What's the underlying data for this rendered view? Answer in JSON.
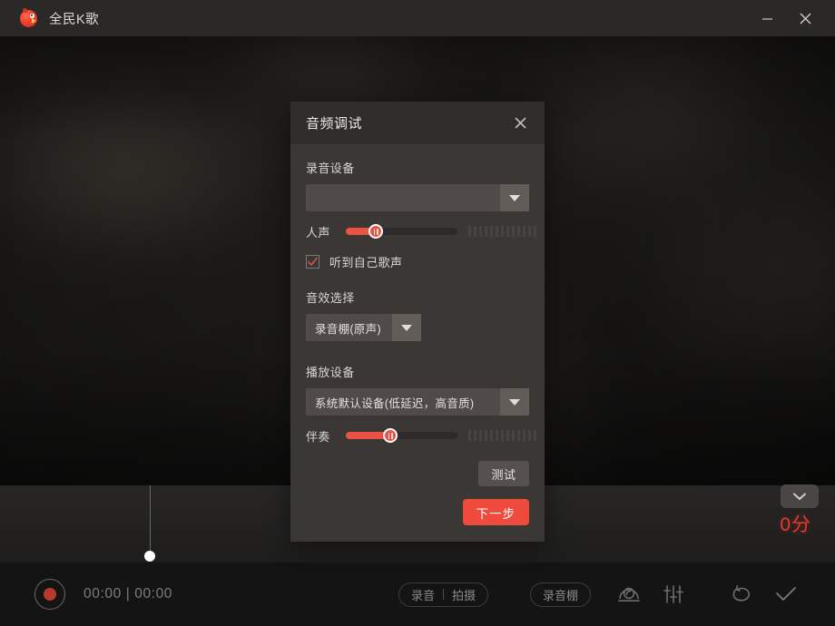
{
  "window": {
    "title": "全民K歌",
    "logo_icon": "kugou-bird-logo",
    "minimize_icon": "minimize-icon",
    "close_icon": "close-icon"
  },
  "stage": {
    "score": "0分",
    "collapse_icon": "chevron-down-icon"
  },
  "toolbar": {
    "record_icon": "record-dot-icon",
    "timer": "00:00 | 00:00",
    "mode_pill": {
      "left": "录音",
      "right": "拍摄"
    },
    "room_pill": "录音棚",
    "icons": [
      {
        "name": "headset-icon",
        "label": "耳机"
      },
      {
        "name": "equalizer-icon",
        "label": "音效调节"
      },
      {
        "name": "redo-icon",
        "label": "重录"
      },
      {
        "name": "check-icon",
        "label": "完成"
      }
    ]
  },
  "dialog": {
    "title": "音频调试",
    "close_icon": "close-icon",
    "record_device": {
      "label": "录音设备",
      "value": "",
      "placeholder": "",
      "arrow_icon": "caret-down-icon"
    },
    "vocal_slider": {
      "label": "人声",
      "value": 27,
      "min": 0,
      "max": 100
    },
    "monitor_checkbox": {
      "label": "听到自己歌声",
      "checked": true,
      "check_icon": "check-mark-icon"
    },
    "effect_select": {
      "label": "音效选择",
      "value": "录音棚(原声)",
      "arrow_icon": "caret-down-icon"
    },
    "playback_device": {
      "label": "播放设备",
      "value": "系统默认设备(低延迟，高音质)",
      "arrow_icon": "caret-down-icon"
    },
    "accomp_slider": {
      "label": "伴奏",
      "value": 40,
      "min": 0,
      "max": 100
    },
    "test_button": "测试",
    "next_button": "下一步"
  },
  "colors": {
    "accent_red": "#ef4b3c",
    "slider_red": "#ea5245",
    "score_red": "#e8392a",
    "dialog_bg": "#3a3735",
    "dialog_header_bg": "#2f2d2b"
  }
}
